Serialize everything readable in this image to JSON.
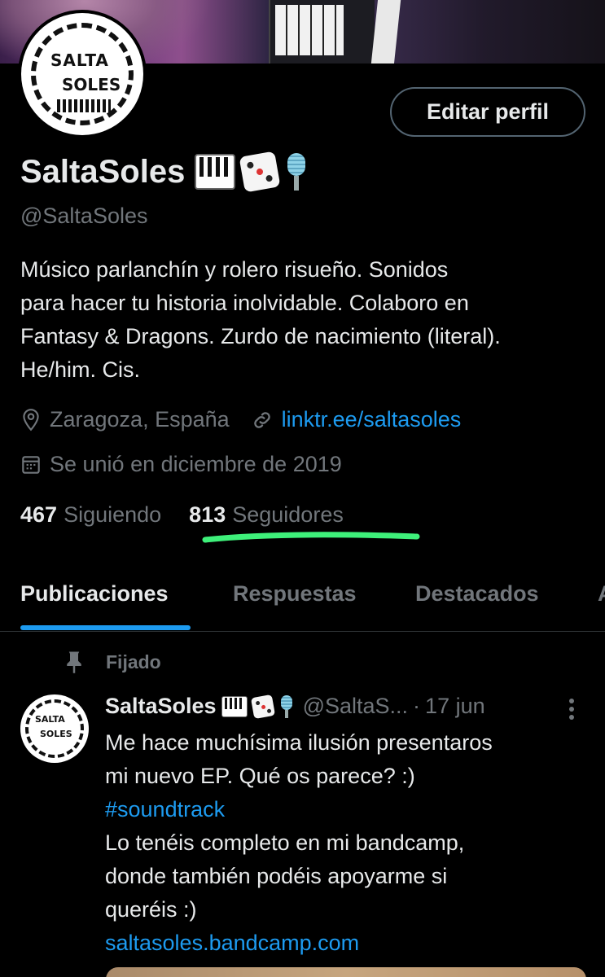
{
  "profile": {
    "edit_button": "Editar perfil",
    "name": "SaltaSoles",
    "handle": "@SaltaSoles",
    "avatar_text_top": "SALTA",
    "avatar_text_bottom": "SOLES",
    "bio_lines": [
      "Músico parlanchín y rolero risueño. Sonidos",
      "para hacer tu historia inolvidable. Colaboro en",
      "Fantasy & Dragons. Zurdo de nacimiento (literal).",
      "He/him. Cis."
    ],
    "location": "Zaragoza, España",
    "website": "linktr.ee/saltasoles",
    "joined": "Se unió en diciembre de 2019",
    "following_count": "467",
    "following_label": "Siguiendo",
    "followers_count": "813",
    "followers_label": "Seguidores",
    "emojis": [
      "piano-emoji",
      "dice-emoji",
      "microphone-emoji"
    ]
  },
  "tabs": [
    {
      "label": "Publicaciones",
      "active": true
    },
    {
      "label": "Respuestas",
      "active": false
    },
    {
      "label": "Destacados",
      "active": false
    },
    {
      "label": "A",
      "active": false
    }
  ],
  "pinned_post": {
    "pinned_label": "Fijado",
    "author_name": "SaltaSoles",
    "author_handle": "@SaltaS...",
    "separator": "·",
    "date": "17 jun",
    "body": {
      "line1": "Me hace muchísima ilusión presentaros",
      "line2": "mi nuevo EP. Qué os parece? :)",
      "hashtag": "#soundtrack",
      "line3": "Lo tenéis completo en mi bandcamp,",
      "line4": "donde también podéis apoyarme si",
      "line5": "queréis :)",
      "link": "saltasoles.bandcamp.com"
    }
  },
  "colors": {
    "background": "#000000",
    "text_primary": "#e7e9ea",
    "text_secondary": "#71767b",
    "accent": "#1d9bf0",
    "highlight_underline": "#3ef07a"
  }
}
